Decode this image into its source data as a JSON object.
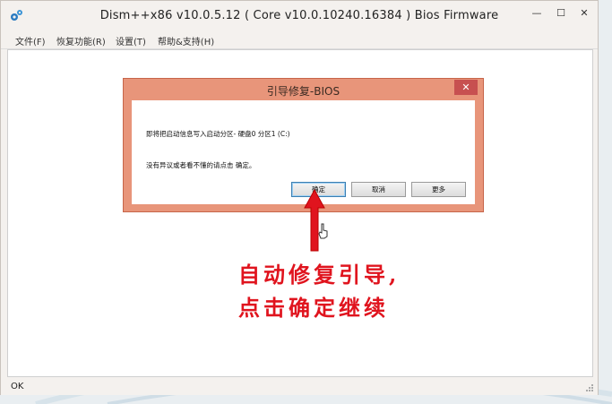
{
  "window": {
    "title": "Dism++x86 v10.0.5.12 ( Core v10.0.10240.16384 ) Bios Firmware",
    "icon": "gears-icon",
    "controls": {
      "minimize": "—",
      "maximize": "☐",
      "close": "✕"
    }
  },
  "menu": {
    "items": [
      {
        "label": "文件(F)"
      },
      {
        "label": "恢复功能(R)"
      },
      {
        "label": "设置(T)"
      },
      {
        "label": "帮助&支持(H)"
      }
    ]
  },
  "dialog": {
    "title": "引导修复-BIOS",
    "close": "✕",
    "message1": "即将把启动信息写入启动分区- 硬盘0 分区1 (C:)",
    "message2": "没有异议或者看不懂的请点击 确定。",
    "buttons": {
      "ok": "确定",
      "cancel": "取消",
      "more": "更多"
    }
  },
  "annotation": {
    "line1": "自动修复引导,",
    "line2": "点击确定继续",
    "color": "#e0141e"
  },
  "status": {
    "text": "OK"
  }
}
